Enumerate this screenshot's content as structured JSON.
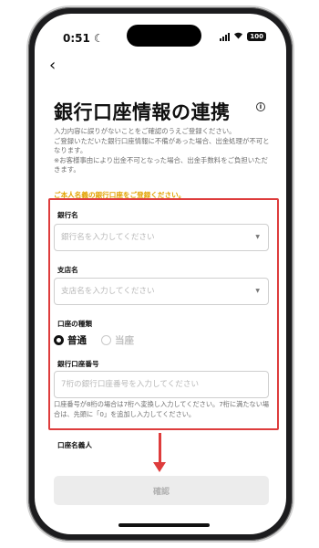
{
  "status_bar": {
    "time": "0:51",
    "moon_icon": "☾",
    "wifi_icon": "wifi-icon",
    "battery": "100"
  },
  "header": {
    "back_icon": "‹",
    "title": "銀行口座情報の連携",
    "info_icon": "i"
  },
  "notes": [
    "入力内容に誤りがないことをご確認のうえご登録ください。",
    "ご登録いただいた銀行口座情報に不備があった場合、出金処理が不可となります。",
    "※お客様事由により出金不可となった場合、出金手数料をご負担いただきます。"
  ],
  "warning": "ご本人名義の銀行口座をご登録ください。",
  "form": {
    "bank": {
      "label": "銀行名",
      "placeholder": "銀行名を入力してください",
      "caret": "▼"
    },
    "branch": {
      "label": "支店名",
      "placeholder": "支店名を入力してください",
      "caret": "▼"
    },
    "account_type": {
      "label": "口座の種類",
      "options": [
        "普通",
        "当座"
      ],
      "selected": "普通"
    },
    "account_number": {
      "label": "銀行口座番号",
      "placeholder": "7桁の銀行口座番号を入力してください",
      "value": "",
      "helper": "口座番号が8桁の場合は7桁へ変換し入力してください。7桁に満たない場合は、先頭に「0」を追加し入力してください。"
    },
    "account_holder": {
      "label": "口座名義人"
    }
  },
  "confirm_button": "確認",
  "colors": {
    "highlight": "#de3c3c",
    "warning": "#e2a200",
    "disabled_button": "#ececec"
  }
}
